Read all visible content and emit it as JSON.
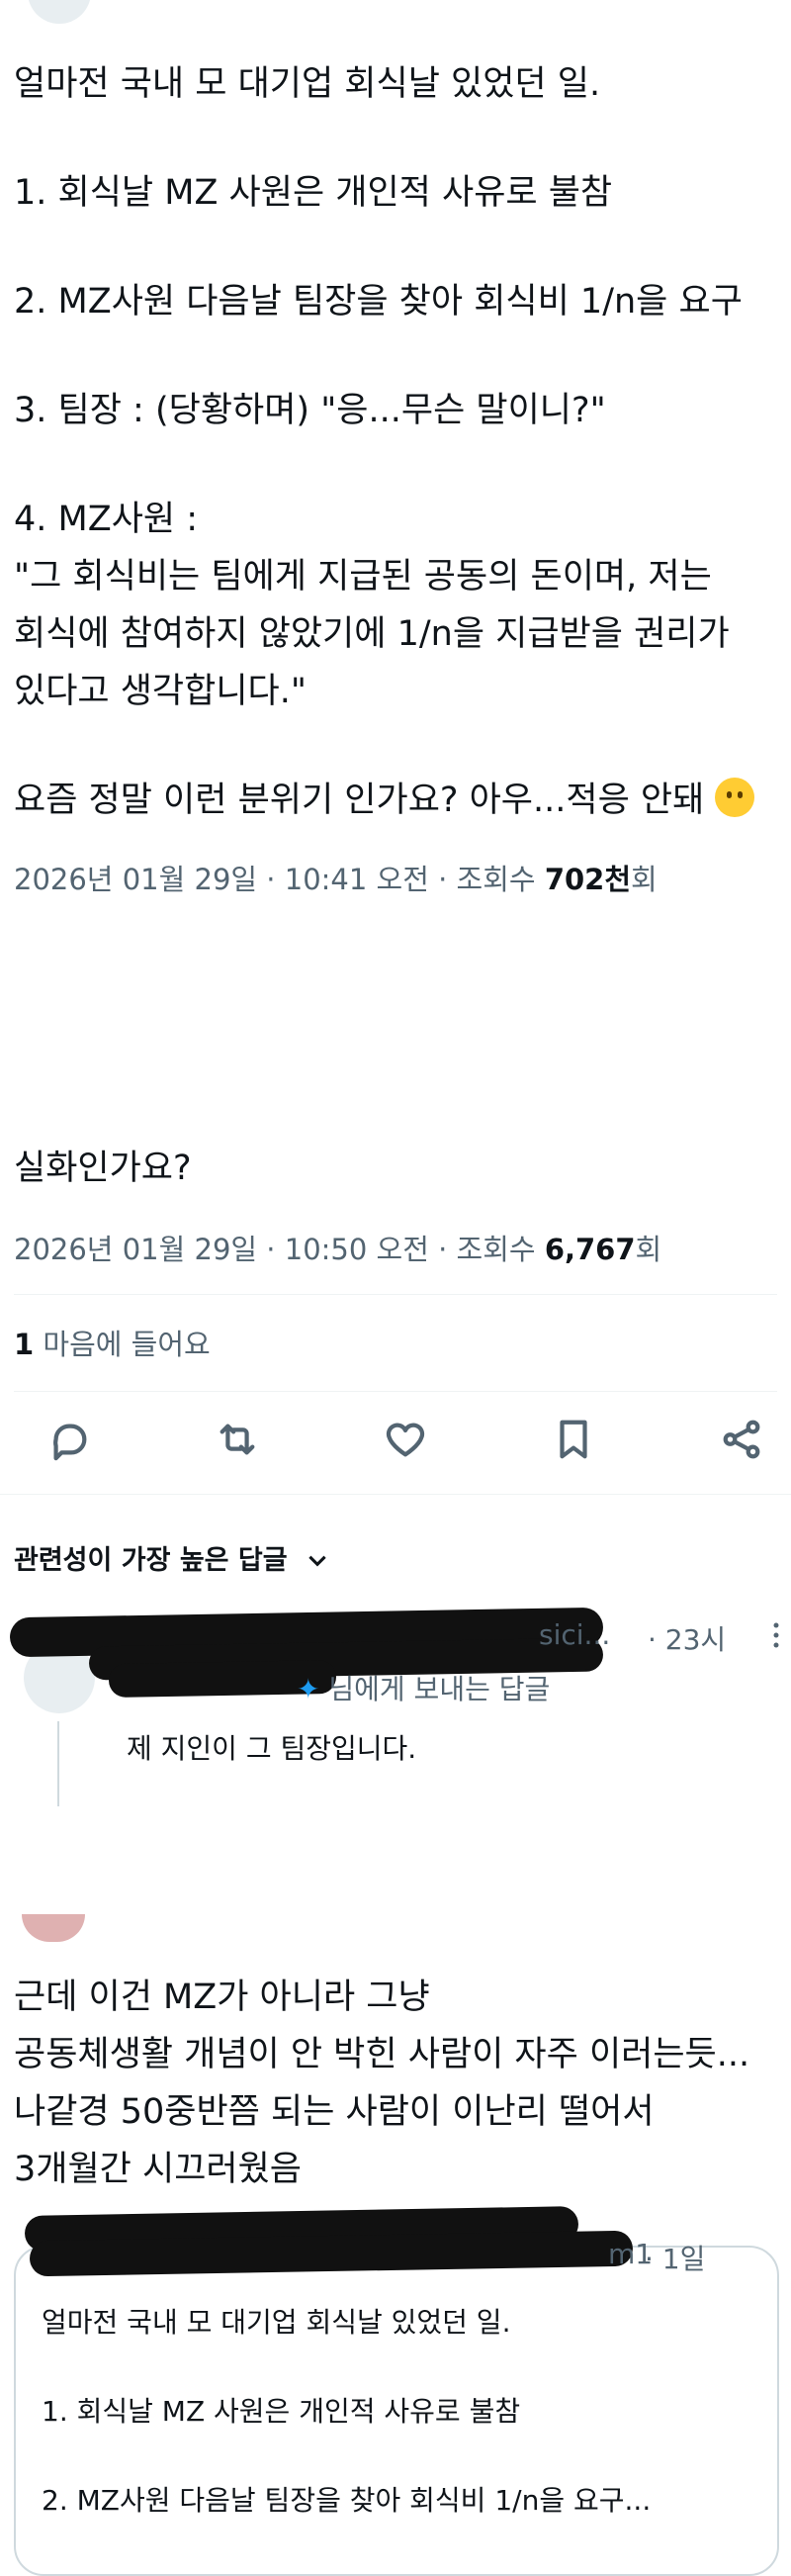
{
  "post": {
    "lines": [
      "얼마전 국내 모 대기업 회식날 있었던 일.",
      "1. 회식날 MZ 사원은 개인적 사유로 불참",
      "2. MZ사원 다음날 팀장을 찾아 회식비 1/n을 요구",
      "3. 팀장 : (당황하며) \"응...무슨 말이니?\"",
      "4. MZ사원 :",
      "\"그 회식비는 팀에게 지급된 공동의 돈이며, 저는",
      "회식에 참여하지 않았기에 1/n을 지급받을 권리가",
      "있다고 생각합니다.\"",
      "요즘 정말 이런 분위기 인가요? 아우...적응 안돼"
    ],
    "meta_prefix": "2026년 01월 29일 · 10:41 오전 · 조회수 ",
    "views": "702천",
    "views_suffix": "회"
  },
  "reply": {
    "text": "실화인가요?",
    "meta_prefix": "2026년 01월 29일 · 10:50 오전 · 조회수 ",
    "views": "6,767",
    "views_suffix": "회",
    "like_count": "1",
    "like_label": "마음에 들어요"
  },
  "actions": [
    "reply-icon",
    "retweet-icon",
    "heart-icon",
    "bookmark-icon",
    "share-icon"
  ],
  "replies_sort": {
    "label": "관련성이 가장 높은 답글"
  },
  "first_reply": {
    "handle_partial": "sici...",
    "time": "· 23시",
    "to_label": "님에게 보내는 답글",
    "text": "제 지인이 그 팀장입니다."
  },
  "quote_post": {
    "lines": [
      "근데 이건 MZ가 아니라 그냥",
      "공동체생활 개념이 안 박힌 사람이 자주 이러는듯...",
      "나같경 50중반쯤 되는 사람이 이난리 떨어서",
      "3개월간 시끄러웠음"
    ],
    "quoted_handle_partial": "m1",
    "quoted_time": "· 1일",
    "quoted_lines": [
      "얼마전 국내 모 대기업 회식날 있었던 일.",
      "1. 회식날 MZ 사원은 개인적 사유로 불참",
      "2. MZ사원 다음날 팀장을 찾아 회식비 1/n을 요구..."
    ]
  },
  "colors": {
    "text": "#0f1419",
    "secondary": "#536471",
    "border": "#cfd9de"
  }
}
